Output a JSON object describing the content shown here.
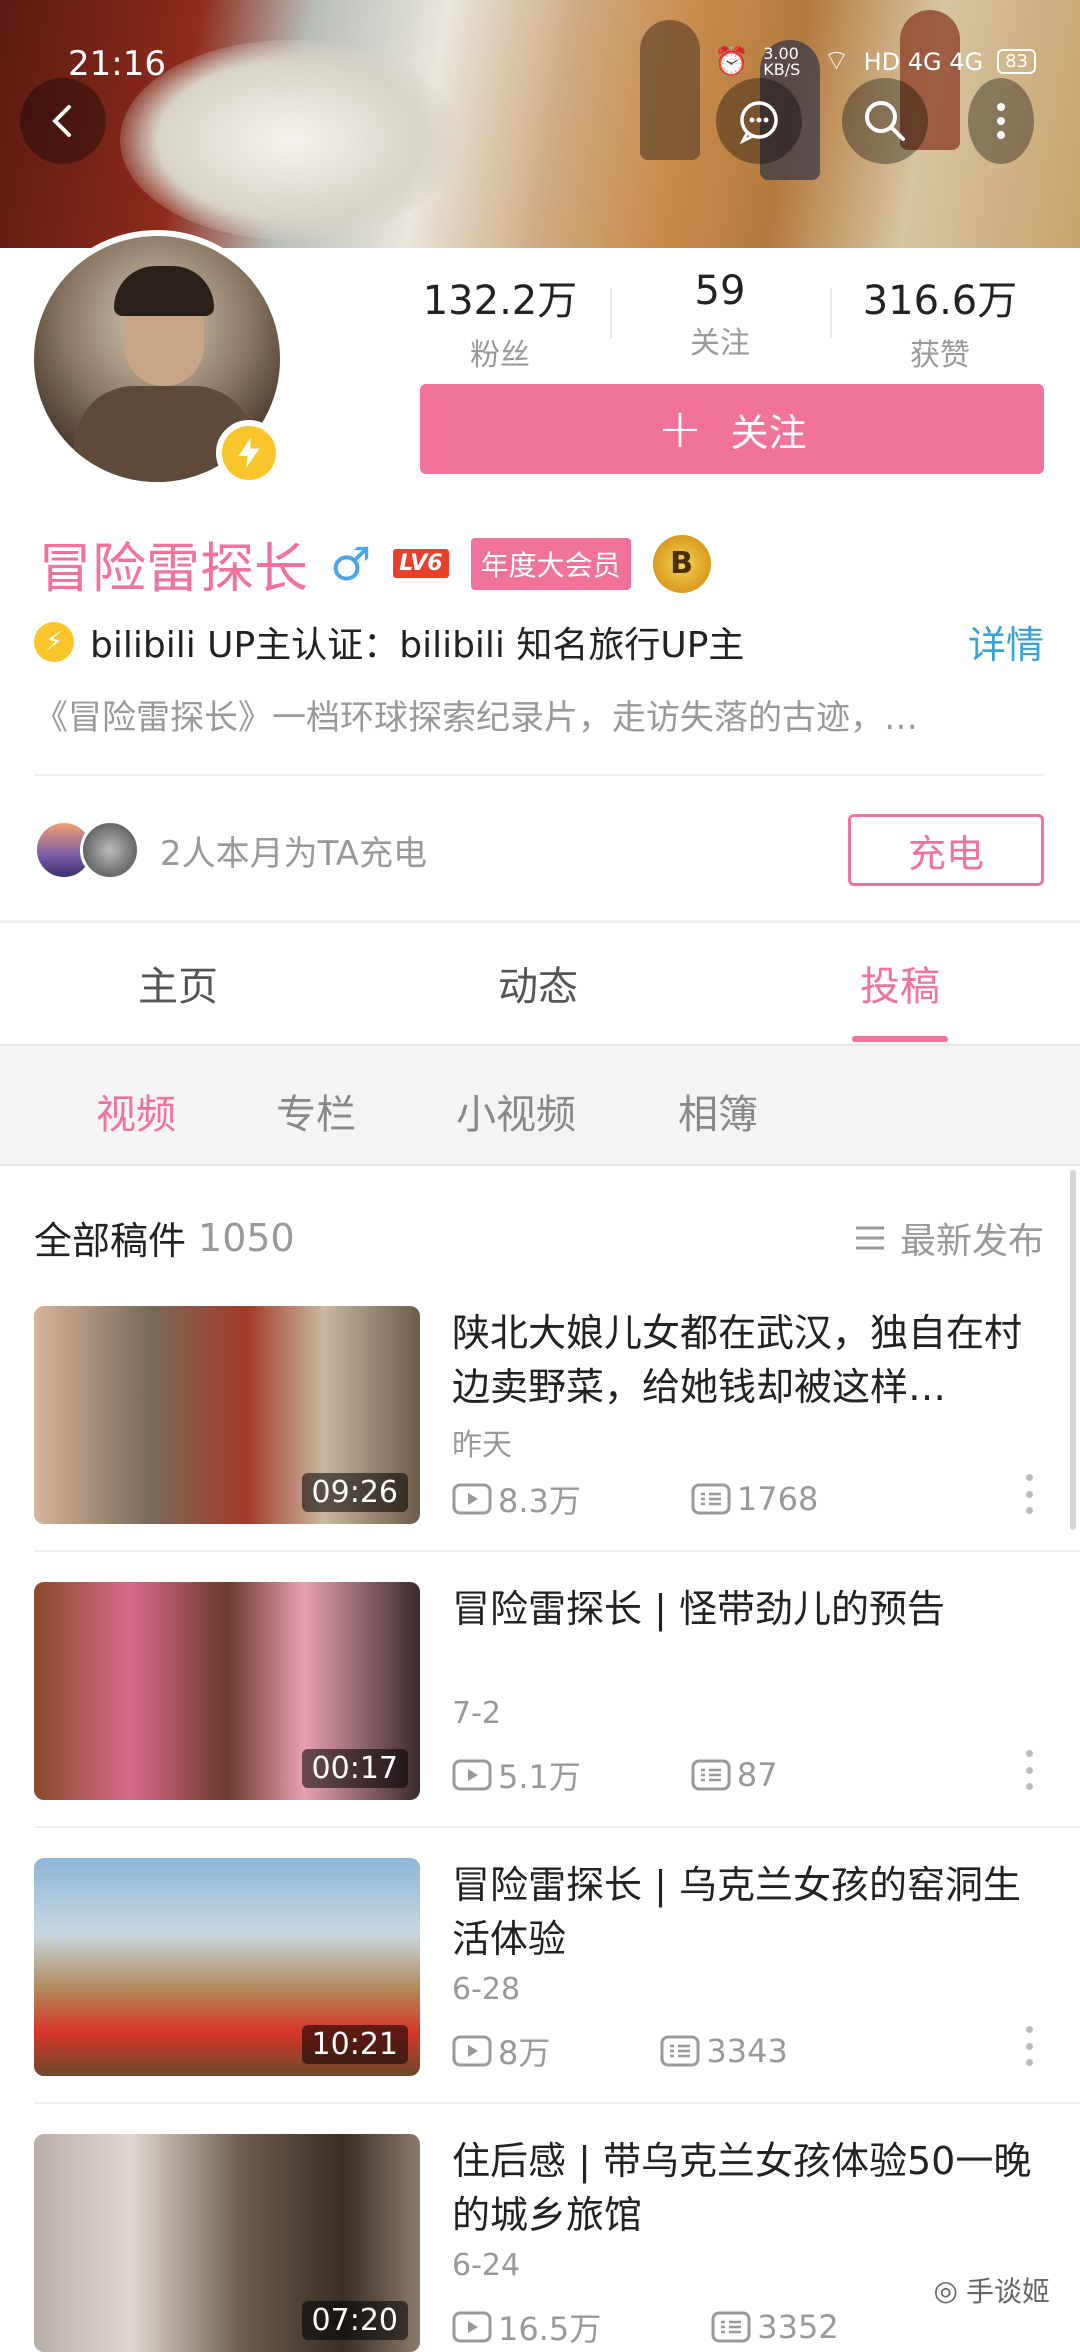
{
  "status": {
    "time": "21:16",
    "speed": "3.00 KB/S",
    "net": "HD 4G 4G",
    "battery": "83"
  },
  "profile": {
    "stats": [
      {
        "value": "132.2万",
        "label": "粉丝"
      },
      {
        "value": "59",
        "label": "关注"
      },
      {
        "value": "316.6万",
        "label": "获赞"
      }
    ],
    "follow_label": "关注",
    "name": "冒险雷探长",
    "gender": "♂",
    "level": "LV6",
    "vip": "年度大会员",
    "medal": "B",
    "cert": "bilibili UP主认证：bilibili 知名旅行UP主",
    "detail": "详情",
    "intro": "《冒险雷探长》一档环球探索纪录片，走访失落的古迹，…",
    "charge_text": "2人本月为TA充电",
    "charge_button": "充电"
  },
  "tabs": [
    {
      "label": "主页",
      "active": false
    },
    {
      "label": "动态",
      "active": false
    },
    {
      "label": "投稿",
      "active": true
    }
  ],
  "subtabs": [
    {
      "label": "视频",
      "active": true
    },
    {
      "label": "专栏",
      "active": false
    },
    {
      "label": "小视频",
      "active": false
    },
    {
      "label": "相簿",
      "active": false
    }
  ],
  "list": {
    "title": "全部稿件",
    "count": "1050",
    "sort": "最新发布",
    "videos": [
      {
        "title": "陕北大娘儿女都在武汉，独自在村边卖野菜，给她钱却被这样…",
        "date": "昨天",
        "duration": "09:26",
        "plays": "8.3万",
        "danmaku": "1768"
      },
      {
        "title": "冒险雷探长 | 怪带劲儿的预告",
        "date": "7-2",
        "duration": "00:17",
        "plays": "5.1万",
        "danmaku": "87"
      },
      {
        "title": "冒险雷探长 | 乌克兰女孩的窑洞生活体验",
        "date": "6-28",
        "duration": "10:21",
        "plays": "8万",
        "danmaku": "3343"
      },
      {
        "title": "住后感 | 带乌克兰女孩体验50一晚的城乡旅馆",
        "date": "6-24",
        "duration": "07:20",
        "plays": "16.5万",
        "danmaku": "3352"
      }
    ]
  },
  "watermark": "手谈姬",
  "colors": {
    "accent": "#f1739a",
    "link": "#3aa3d6",
    "badge": "#f9c52b"
  }
}
